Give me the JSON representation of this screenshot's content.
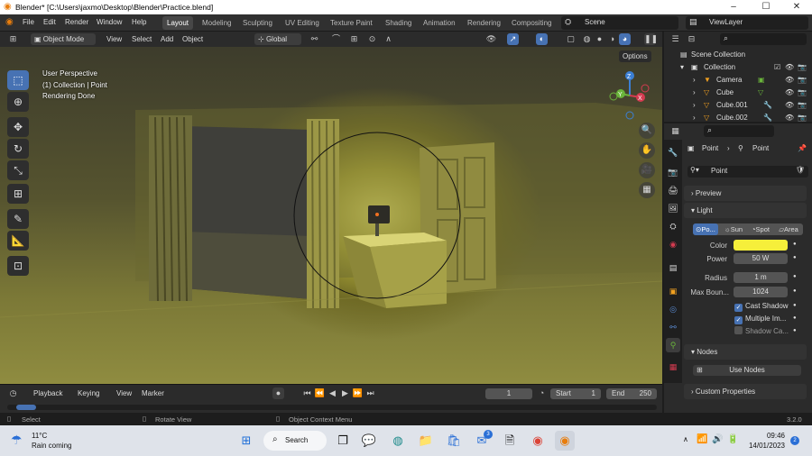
{
  "window": {
    "title": "Blender* [C:\\Users\\jaxmo\\Desktop\\Blender\\Practice.blend]",
    "controls": [
      "–",
      "☐",
      "✕"
    ]
  },
  "menubar": {
    "menus": [
      "File",
      "Edit",
      "Render",
      "Window",
      "Help"
    ],
    "workspaces": [
      "Layout",
      "Modeling",
      "Sculpting",
      "UV Editing",
      "Texture Paint",
      "Shading",
      "Animation",
      "Rendering",
      "Compositing"
    ],
    "scene": "Scene",
    "view_layer": "ViewLayer"
  },
  "viewport_header": {
    "mode": "Object Mode",
    "menus": [
      "View",
      "Select",
      "Add",
      "Object"
    ],
    "orientation": "Global",
    "options": "Options"
  },
  "viewport": {
    "perspective": "User Perspective",
    "collection": "(1) Collection | Point",
    "status": "Rendering Done",
    "gizmo": {
      "x": "X",
      "y": "Y",
      "z": "Z"
    }
  },
  "timeline": {
    "menus": [
      "Playback",
      "Keying",
      "View",
      "Marker"
    ],
    "current_frame": "1",
    "start_label": "Start",
    "start": "1",
    "end_label": "End",
    "end": "250"
  },
  "statusbar": {
    "select": "Select",
    "rotate": "Rotate View",
    "context": "Object Context Menu",
    "version": "3.2.0"
  },
  "outliner": {
    "search_placeholder": "",
    "root": "Scene Collection",
    "collection": "Collection",
    "items": [
      "Camera",
      "Cube",
      "Cube.001",
      "Cube.002"
    ]
  },
  "properties": {
    "breadcrumb_object": "Point",
    "breadcrumb_data": "Point",
    "datablock": "Point",
    "panels": {
      "preview": "Preview",
      "light": "Light",
      "nodes": "Nodes",
      "custom": "Custom Properties"
    },
    "light_types": [
      "Po...",
      "Sun",
      "Spot",
      "Area"
    ],
    "color_label": "Color",
    "color": "#f6ef3a",
    "power_label": "Power",
    "power": "50 W",
    "radius_label": "Radius",
    "radius": "1 m",
    "max_bounces_label": "Max Boun...",
    "max_bounces": "1024",
    "cast_shadow": "Cast Shadow",
    "multiple_importance": "Multiple Im...",
    "shadow_caustics": "Shadow Ca...",
    "use_nodes": "Use Nodes"
  },
  "taskbar": {
    "weather_temp": "11°C",
    "weather_desc": "Rain coming",
    "search": "Search",
    "time": "09:46",
    "date": "14/01/2023",
    "badge": "3",
    "notif": "2"
  },
  "colors": {
    "accent": "#4772b3",
    "active_icon": "#f0a020"
  }
}
